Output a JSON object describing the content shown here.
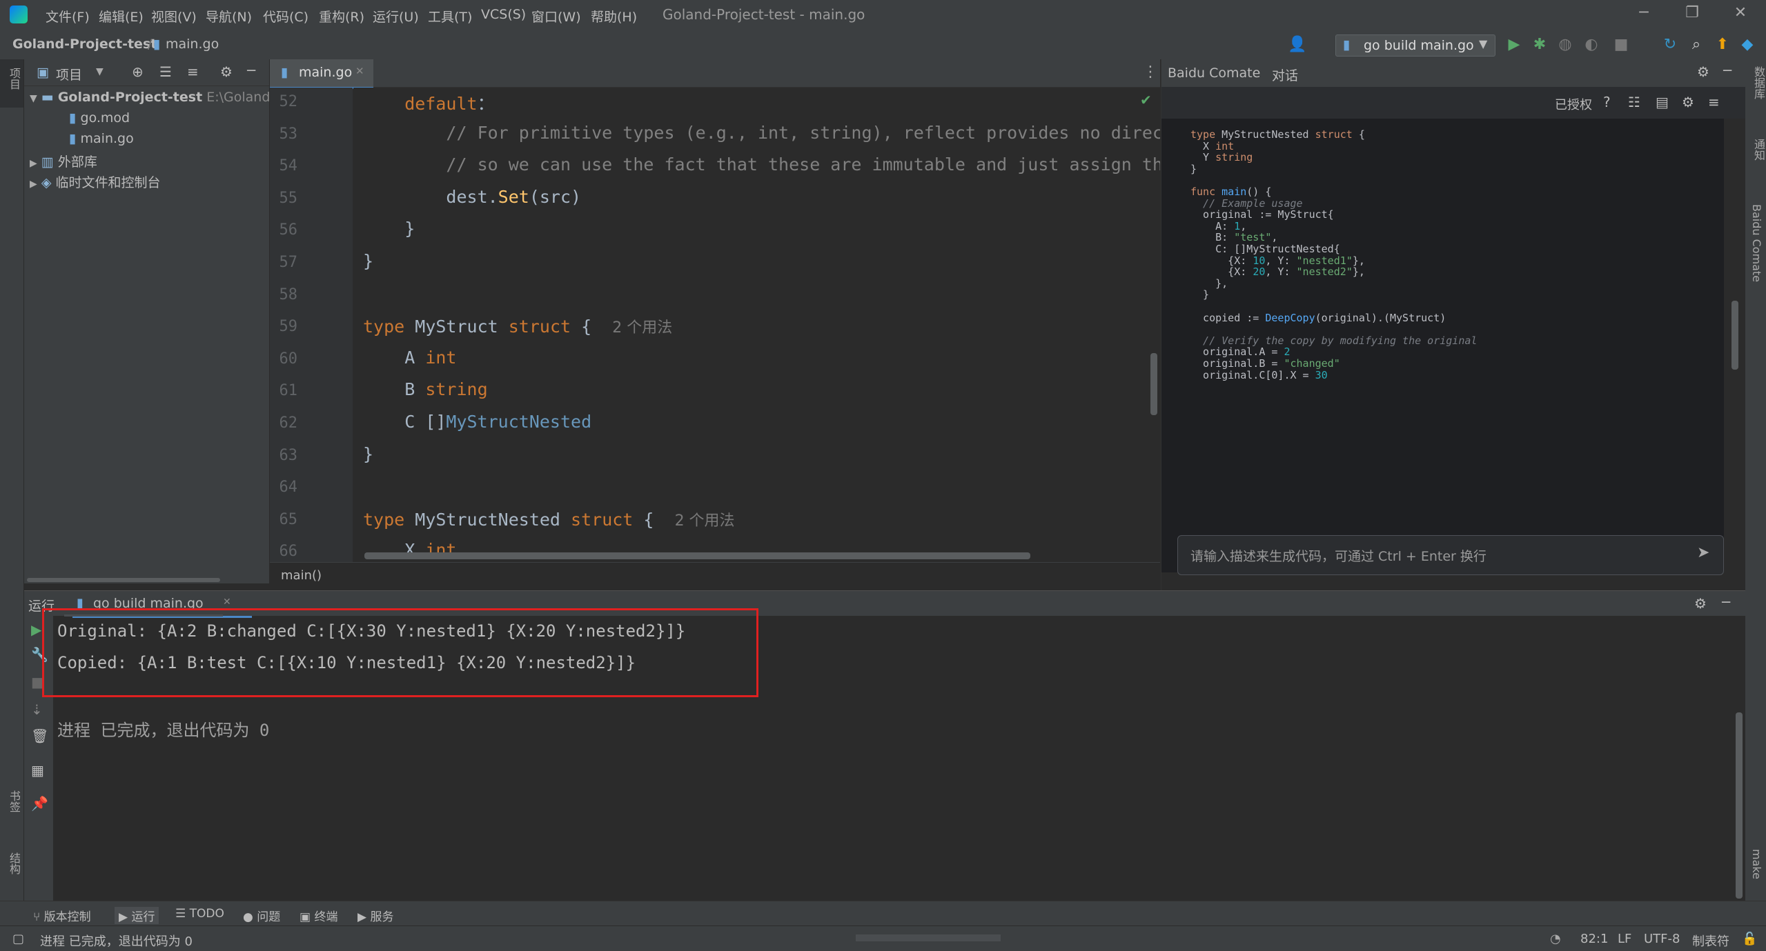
{
  "window": {
    "app_title": "Goland-Project-test - main.go",
    "menu": [
      "文件(F)",
      "编辑(E)",
      "视图(V)",
      "导航(N)",
      "代码(C)",
      "重构(R)",
      "运行(U)",
      "工具(T)",
      "VCS(S)",
      "窗口(W)",
      "帮助(H)"
    ]
  },
  "navbar": {
    "project": "Goland-Project-test",
    "file": "main.go",
    "run_config": "go build main.go"
  },
  "left_stripe": {
    "project": "项目",
    "bookmarks": "书签",
    "structure": "结构"
  },
  "project_panel": {
    "title": "项目",
    "root": "Goland-Project-test",
    "root_path": "E:\\Goland-Pr",
    "items": [
      "go.mod",
      "main.go",
      "外部库",
      "临时文件和控制台"
    ]
  },
  "editor": {
    "tab": "main.go",
    "breadcrumb": "main()",
    "lines": [
      {
        "n": "52",
        "segs": [
          [
            "kw",
            "    default"
          ],
          [
            "",
            "："
          ]
        ]
      },
      {
        "n": "53",
        "segs": [
          [
            "cm",
            "        // For primitive types (e.g., int, string), reflect provides no direct way"
          ]
        ]
      },
      {
        "n": "54",
        "segs": [
          [
            "cm",
            "        // so we can use the fact that these are immutable and just assign the src"
          ]
        ]
      },
      {
        "n": "55",
        "segs": [
          [
            "",
            "        dest."
          ],
          [
            "fn",
            "Set"
          ],
          [
            "",
            "(src)"
          ]
        ]
      },
      {
        "n": "56",
        "segs": [
          [
            "",
            "    }"
          ]
        ]
      },
      {
        "n": "57",
        "segs": [
          [
            "",
            "}"
          ]
        ]
      },
      {
        "n": "58",
        "segs": [
          [
            "",
            ""
          ]
        ]
      },
      {
        "n": "59",
        "segs": [
          [
            "kw",
            "type "
          ],
          [
            "",
            "MyStruct "
          ],
          [
            "kw",
            "struct "
          ],
          [
            "",
            "{  "
          ],
          [
            "hint",
            "2 个用法"
          ]
        ]
      },
      {
        "n": "60",
        "segs": [
          [
            "",
            "    A "
          ],
          [
            "kw",
            "int"
          ]
        ]
      },
      {
        "n": "61",
        "segs": [
          [
            "",
            "    B "
          ],
          [
            "kw",
            "string"
          ]
        ]
      },
      {
        "n": "62",
        "segs": [
          [
            "",
            "    C []"
          ],
          [
            "ty",
            "MyStructNested"
          ]
        ]
      },
      {
        "n": "63",
        "segs": [
          [
            "",
            "}"
          ]
        ]
      },
      {
        "n": "64",
        "segs": [
          [
            "",
            ""
          ]
        ]
      },
      {
        "n": "65",
        "segs": [
          [
            "kw",
            "type "
          ],
          [
            "",
            "MyStructNested "
          ],
          [
            "kw",
            "struct "
          ],
          [
            "",
            "{  "
          ],
          [
            "hint",
            "2 个用法"
          ]
        ]
      },
      {
        "n": "66",
        "segs": [
          [
            "",
            "    X "
          ],
          [
            "kw",
            "int"
          ]
        ]
      }
    ]
  },
  "comate": {
    "title": "Baidu Comate",
    "tab": "对话",
    "authorized": "已授权",
    "input_placeholder": "请输入描述来生成代码，可通过 Ctrl + Enter 换行",
    "code": [
      [
        [
          "k",
          "type "
        ],
        [
          "",
          "MyStructNested "
        ],
        [
          "k",
          "struct"
        ],
        [
          "",
          " {"
        ]
      ],
      [
        [
          "",
          "  X "
        ],
        [
          "k",
          "int"
        ]
      ],
      [
        [
          "",
          "  Y "
        ],
        [
          "k",
          "string"
        ]
      ],
      [
        [
          "",
          "}"
        ]
      ],
      [
        [
          "",
          ""
        ]
      ],
      [
        [
          "k",
          "func "
        ],
        [
          "f",
          "main"
        ],
        [
          "",
          "() {"
        ]
      ],
      [
        [
          "c",
          "  // Example usage"
        ]
      ],
      [
        [
          "",
          "  original := MyStruct{"
        ]
      ],
      [
        [
          "",
          "    A: "
        ],
        [
          "n",
          "1"
        ],
        [
          "",
          ","
        ]
      ],
      [
        [
          "",
          "    B: "
        ],
        [
          "s",
          "\"test\""
        ],
        [
          "",
          ","
        ]
      ],
      [
        [
          "",
          "    C: []MyStructNested{"
        ]
      ],
      [
        [
          "",
          "      {X: "
        ],
        [
          "n",
          "10"
        ],
        [
          "",
          ", Y: "
        ],
        [
          "s",
          "\"nested1\""
        ],
        [
          "",
          "},"
        ]
      ],
      [
        [
          "",
          "      {X: "
        ],
        [
          "n",
          "20"
        ],
        [
          "",
          ", Y: "
        ],
        [
          "s",
          "\"nested2\""
        ],
        [
          "",
          "},"
        ]
      ],
      [
        [
          "",
          "    },"
        ]
      ],
      [
        [
          "",
          "  }"
        ]
      ],
      [
        [
          "",
          ""
        ]
      ],
      [
        [
          "",
          "  copied := "
        ],
        [
          "f",
          "DeepCopy"
        ],
        [
          "",
          "(original).(MyStruct)"
        ]
      ],
      [
        [
          "",
          ""
        ]
      ],
      [
        [
          "c",
          "  // Verify the copy by modifying the original"
        ]
      ],
      [
        [
          "",
          "  original.A = "
        ],
        [
          "n",
          "2"
        ]
      ],
      [
        [
          "",
          "  original.B = "
        ],
        [
          "s",
          "\"changed\""
        ]
      ],
      [
        [
          "",
          "  original.C[0].X = "
        ],
        [
          "n",
          "30"
        ]
      ]
    ]
  },
  "right_stripe": {
    "db": "数据库",
    "notify": "通知",
    "comate": "Baidu Comate",
    "make": "make"
  },
  "run_window": {
    "label": "运行",
    "tab": "go build main.go",
    "output": [
      "Original: {A:2 B:changed C:[{X:30 Y:nested1} {X:20 Y:nested2}]}",
      "Copied: {A:1 B:test C:[{X:10 Y:nested1} {X:20 Y:nested2}]}",
      "",
      "进程 已完成，退出代码为 0"
    ]
  },
  "bottom_tools": [
    "版本控制",
    "运行",
    "TODO",
    "问题",
    "终端",
    "服务"
  ],
  "status": {
    "message": "进程 已完成，退出代码为 0",
    "position": "82:1",
    "line_sep": "LF",
    "encoding": "UTF-8",
    "indent": "制表符"
  },
  "colors": {
    "highlight_box": "#e02020",
    "accent": "#4a88c7"
  }
}
